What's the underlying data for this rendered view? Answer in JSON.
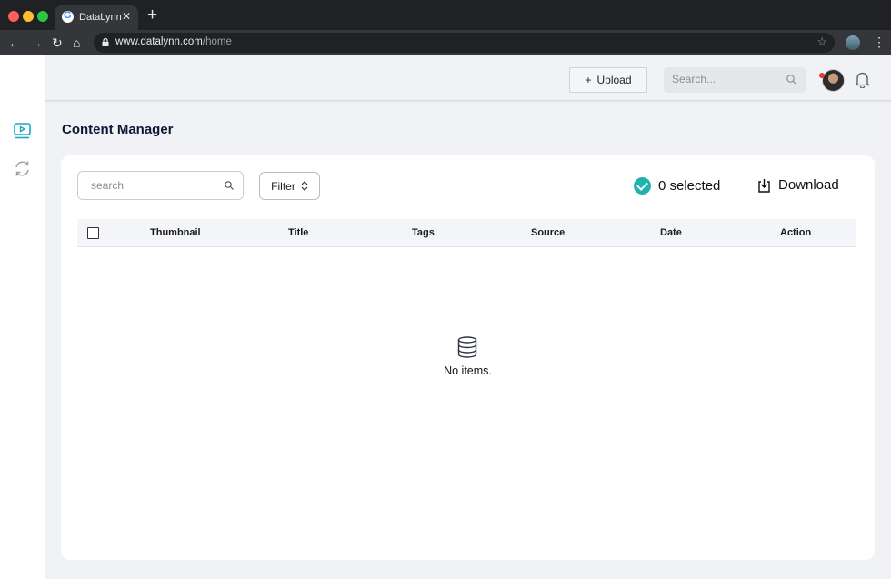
{
  "browser": {
    "tab_title": "DataLynn",
    "tab_close": "✕",
    "new_tab": "+",
    "url_host": "www.datalynn.com",
    "url_path": "/home",
    "icons": [
      "back-icon",
      "forward-icon",
      "reload-icon",
      "home-icon",
      "lock-icon",
      "star-icon",
      "profile-icon",
      "menu-icon"
    ]
  },
  "sidebar": {
    "items": [
      {
        "icon": "video-icon",
        "active": true,
        "color": "#1fa5c4"
      },
      {
        "icon": "sync-icon",
        "active": false,
        "color": "#9aa0a6"
      }
    ]
  },
  "header": {
    "upload_icon": "+",
    "upload_label": "Upload",
    "search_placeholder": "Search...",
    "notification_badge": true
  },
  "page": {
    "title": "Content Manager"
  },
  "content": {
    "search_placeholder": "search",
    "filter_label": "Filter",
    "filter_icon": "⌃⌄",
    "selected_count_text": "0 selected",
    "download_label": "Download",
    "columns": [
      "Thumbnail",
      "Title",
      "Tags",
      "Source",
      "Date",
      "Action"
    ],
    "empty_text": "No items."
  },
  "colors": {
    "accent": "#1fb2ae",
    "title": "#0d1733",
    "background": "#f1f2f6"
  }
}
